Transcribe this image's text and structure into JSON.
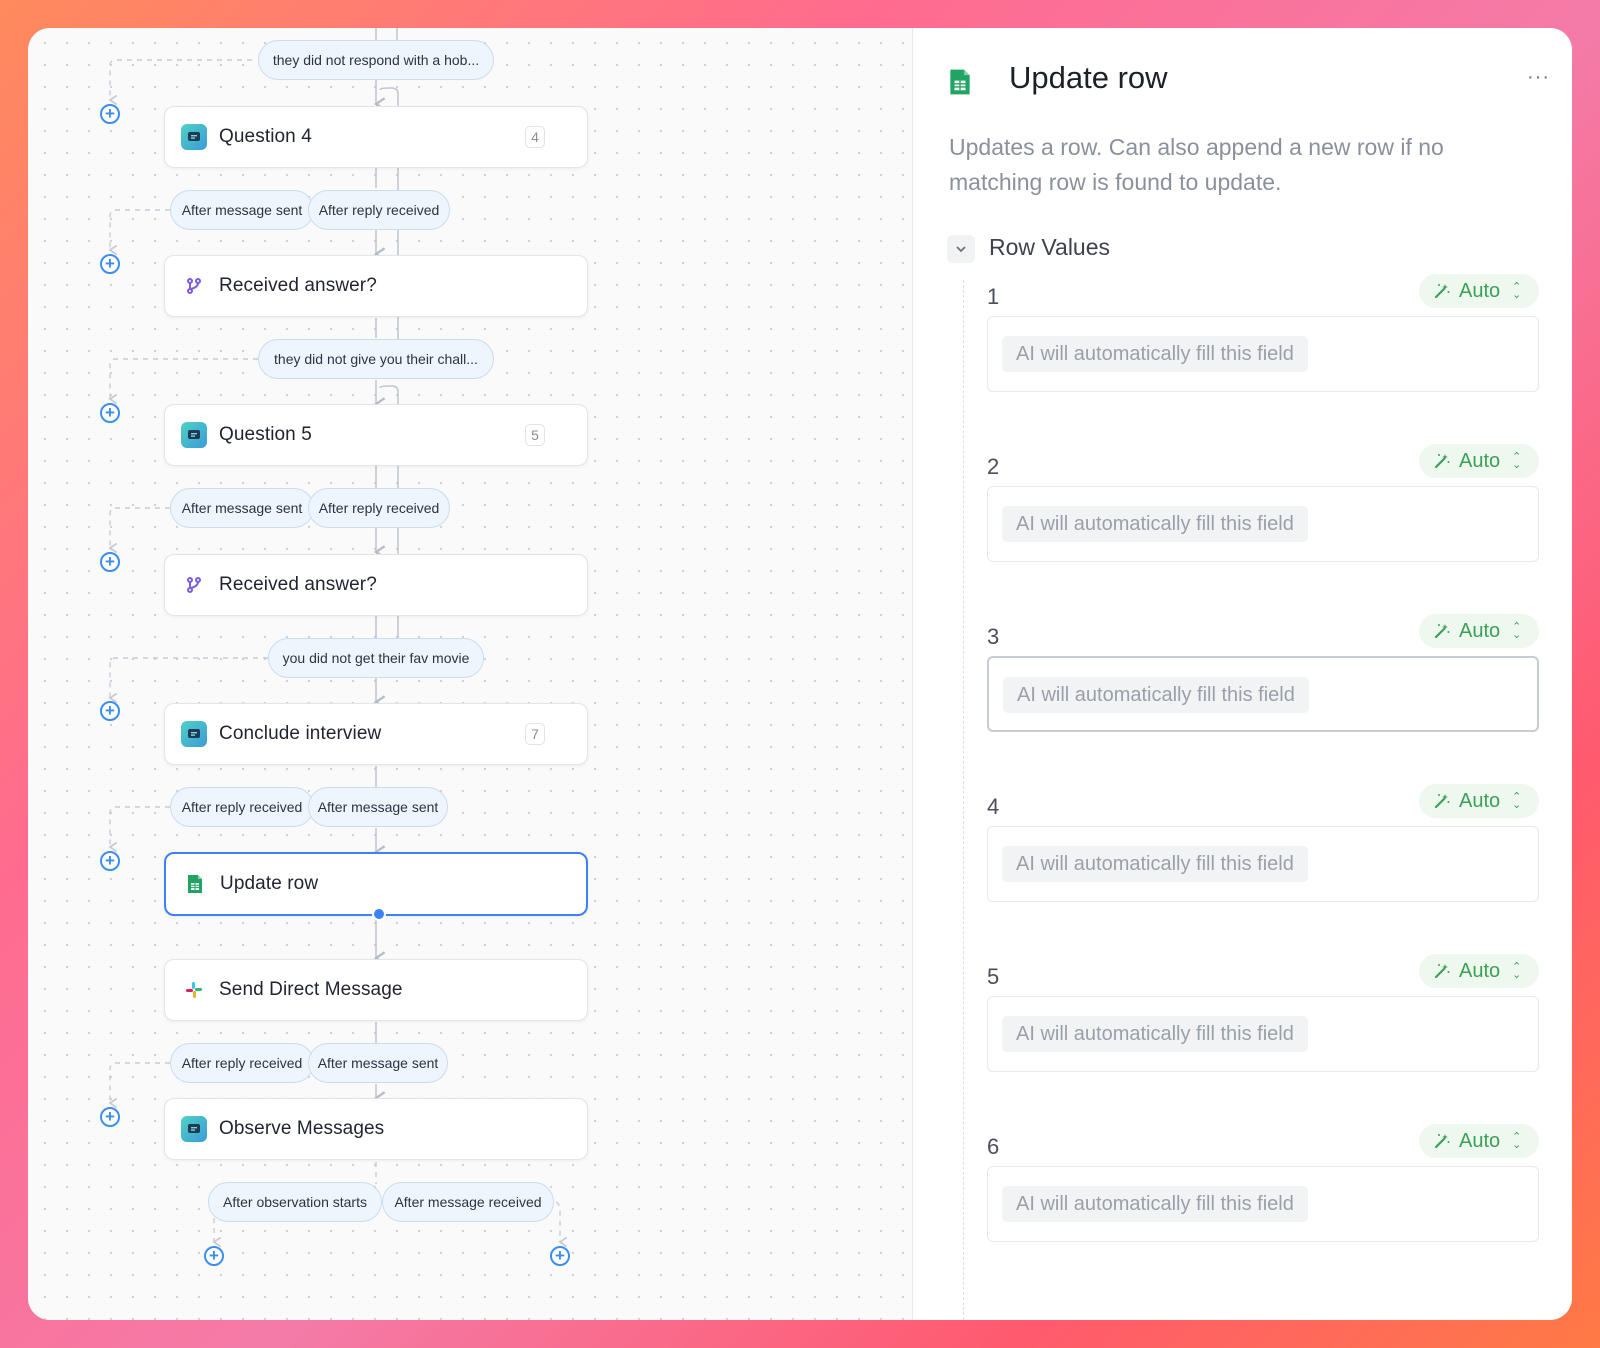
{
  "flow": {
    "conditions": {
      "c1": "they did not respond with a hob...",
      "c2": "they did not give you their chall...",
      "c3": "you did not get their fav movie"
    },
    "nodes": {
      "question4": {
        "title": "Question 4",
        "count": "4"
      },
      "received1": {
        "title": "Received answer?"
      },
      "question5": {
        "title": "Question 5",
        "count": "5"
      },
      "received2": {
        "title": "Received answer?"
      },
      "conclude": {
        "title": "Conclude interview",
        "count": "7"
      },
      "updaterow": {
        "title": "Update row"
      },
      "senddm": {
        "title": "Send Direct Message"
      },
      "observe": {
        "title": "Observe Messages"
      }
    },
    "triggers": {
      "after_message_sent": "After message sent",
      "after_reply_received": "After reply received",
      "after_observation_starts": "After observation starts",
      "after_message_received": "After message received"
    },
    "add_icon": "plus-circle-icon"
  },
  "panel": {
    "title": "Update row",
    "more": "···",
    "description": "Updates a row. Can also append a new row if no matching row is found to update.",
    "section": "Row Values",
    "rows": [
      {
        "num": "1",
        "mode": "Auto",
        "placeholder": "AI will automatically fill this field"
      },
      {
        "num": "2",
        "mode": "Auto",
        "placeholder": "AI will automatically fill this field"
      },
      {
        "num": "3",
        "mode": "Auto",
        "placeholder": "AI will automatically fill this field"
      },
      {
        "num": "4",
        "mode": "Auto",
        "placeholder": "AI will automatically fill this field"
      },
      {
        "num": "5",
        "mode": "Auto",
        "placeholder": "AI will automatically fill this field"
      },
      {
        "num": "6",
        "mode": "Auto",
        "placeholder": "AI will automatically fill this field"
      }
    ]
  },
  "colors": {
    "accent": "#3b82f6",
    "auto_green": "#3aa156",
    "sheet_green": "#1fa463"
  }
}
